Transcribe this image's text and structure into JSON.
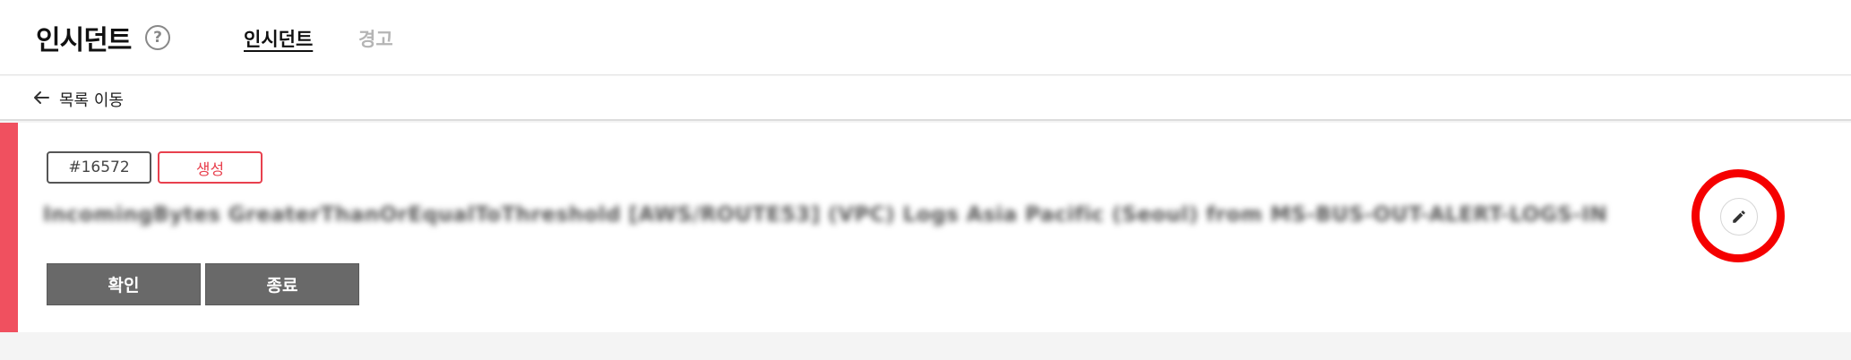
{
  "header": {
    "title": "인시던트",
    "help_glyph": "?",
    "tabs": [
      {
        "label": "인시던트",
        "active": true
      },
      {
        "label": "경고",
        "active": false
      }
    ]
  },
  "nav": {
    "back_label": "목록 이동"
  },
  "incident": {
    "id": "#16572",
    "status": "생성",
    "title": "IncomingBytes GreaterThanOrEqualToThreshold [AWS/ROUTE53] (VPC) Logs Asia Pacific (Seoul) from MS-BUS-OUT-ALERT-LOGS-IN",
    "accent_color": "#f0505f",
    "status_color": "#e8404e"
  },
  "actions": {
    "confirm_label": "확인",
    "close_label": "종료"
  },
  "icons": {
    "help": "help-circle-icon",
    "back": "arrow-left-icon",
    "edit": "pencil-icon"
  }
}
